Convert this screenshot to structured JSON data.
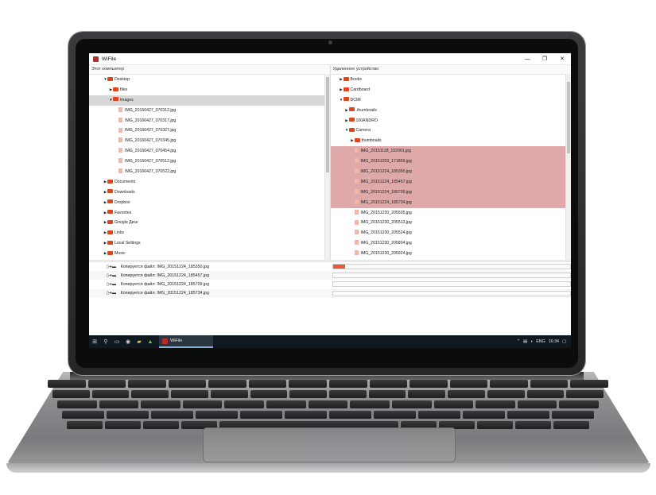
{
  "app": {
    "title": "WiFile"
  },
  "window": {
    "minimize_glyph": "—",
    "restore_glyph": "❐",
    "close_glyph": "✕"
  },
  "left_pane": {
    "header": "Этот компьютер",
    "rows": [
      {
        "label": "Desktop",
        "type": "folder",
        "depth": 2,
        "expanded": true
      },
      {
        "label": "files",
        "type": "folder",
        "depth": 3,
        "expanded": false
      },
      {
        "label": "images",
        "type": "folder",
        "depth": 3,
        "expanded": true,
        "selected": "gray"
      },
      {
        "label": "IMG_20160427_070312.jpg",
        "type": "file",
        "depth": 4
      },
      {
        "label": "IMG_20160427_070317.jpg",
        "type": "file",
        "depth": 4
      },
      {
        "label": "IMG_20160427_070327.jpg",
        "type": "file",
        "depth": 4
      },
      {
        "label": "IMG_20160427_070345.jpg",
        "type": "file",
        "depth": 4
      },
      {
        "label": "IMG_20160427_070454.jpg",
        "type": "file",
        "depth": 4
      },
      {
        "label": "IMG_20160427_070512.jpg",
        "type": "file",
        "depth": 4
      },
      {
        "label": "IMG_20160427_070522.jpg",
        "type": "file",
        "depth": 4
      },
      {
        "label": "Documents",
        "type": "folder",
        "depth": 2,
        "expanded": false
      },
      {
        "label": "Downloads",
        "type": "folder",
        "depth": 2,
        "expanded": false
      },
      {
        "label": "Dropbox",
        "type": "folder",
        "depth": 2,
        "expanded": false
      },
      {
        "label": "Favorites",
        "type": "folder",
        "depth": 2,
        "expanded": false
      },
      {
        "label": "Google Диск",
        "type": "folder",
        "depth": 2,
        "expanded": false
      },
      {
        "label": "Links",
        "type": "folder",
        "depth": 2,
        "expanded": false
      },
      {
        "label": "Local Settings",
        "type": "folder",
        "depth": 2,
        "expanded": false
      },
      {
        "label": "Music",
        "type": "folder",
        "depth": 2,
        "expanded": false
      }
    ]
  },
  "right_pane": {
    "header": "Удаленное устройство",
    "rows": [
      {
        "label": "Books",
        "type": "folder",
        "depth": 1,
        "expanded": false
      },
      {
        "label": "Cardboard",
        "type": "folder",
        "depth": 1,
        "expanded": false
      },
      {
        "label": "DCIM",
        "type": "folder",
        "depth": 1,
        "expanded": true
      },
      {
        "label": ".thumbnails",
        "type": "folder",
        "depth": 2,
        "expanded": false
      },
      {
        "label": "100ANDRO",
        "type": "folder",
        "depth": 2,
        "expanded": false
      },
      {
        "label": "Camera",
        "type": "folder",
        "depth": 2,
        "expanded": true
      },
      {
        "label": "thumbnails",
        "type": "folder",
        "depth": 3,
        "expanded": false
      },
      {
        "label": "IMG_20151118_102001.jpg",
        "type": "file",
        "depth": 3,
        "selected": "red"
      },
      {
        "label": "IMG_20151203_171859.jpg",
        "type": "file",
        "depth": 3,
        "selected": "red"
      },
      {
        "label": "IMG_20151224_185350.jpg",
        "type": "file",
        "depth": 3,
        "selected": "red"
      },
      {
        "label": "IMG_20151224_185457.jpg",
        "type": "file",
        "depth": 3,
        "selected": "red"
      },
      {
        "label": "IMG_20151224_185709.jpg",
        "type": "file",
        "depth": 3,
        "selected": "red"
      },
      {
        "label": "IMG_20151224_185734.jpg",
        "type": "file",
        "depth": 3,
        "selected": "red"
      },
      {
        "label": "IMG_20151230_205505.jpg",
        "type": "file",
        "depth": 3
      },
      {
        "label": "IMG_20151230_205513.jpg",
        "type": "file",
        "depth": 3
      },
      {
        "label": "IMG_20151230_205524.jpg",
        "type": "file",
        "depth": 3
      },
      {
        "label": "IMG_20151230_205804.jpg",
        "type": "file",
        "depth": 3
      },
      {
        "label": "IMG_20151230_205924.jpg",
        "type": "file",
        "depth": 3
      }
    ]
  },
  "queue": [
    {
      "label": "Копируется файл: IMG_20151224_185350.jpg",
      "progress": 0.05
    },
    {
      "label": "Копируется файл: IMG_20151224_185457.jpg",
      "progress": 0
    },
    {
      "label": "Копируется файл: IMG_20151224_185709.jpg",
      "progress": 0
    },
    {
      "label": "Копируется файл: IMG_20151224_185734.jpg",
      "progress": 0
    }
  ],
  "taskbar": {
    "app_label": "WiFile",
    "language": "ENG",
    "clock": "16:34",
    "icons": [
      "windows-start-icon",
      "search-icon",
      "task-view-icon",
      "chrome-icon",
      "folder-icon",
      "android-icon"
    ]
  },
  "colors": {
    "accent": "#e25b3d",
    "selection_red": "#dfa9a9",
    "folder": "#e0461e",
    "taskbar": "#101820"
  }
}
